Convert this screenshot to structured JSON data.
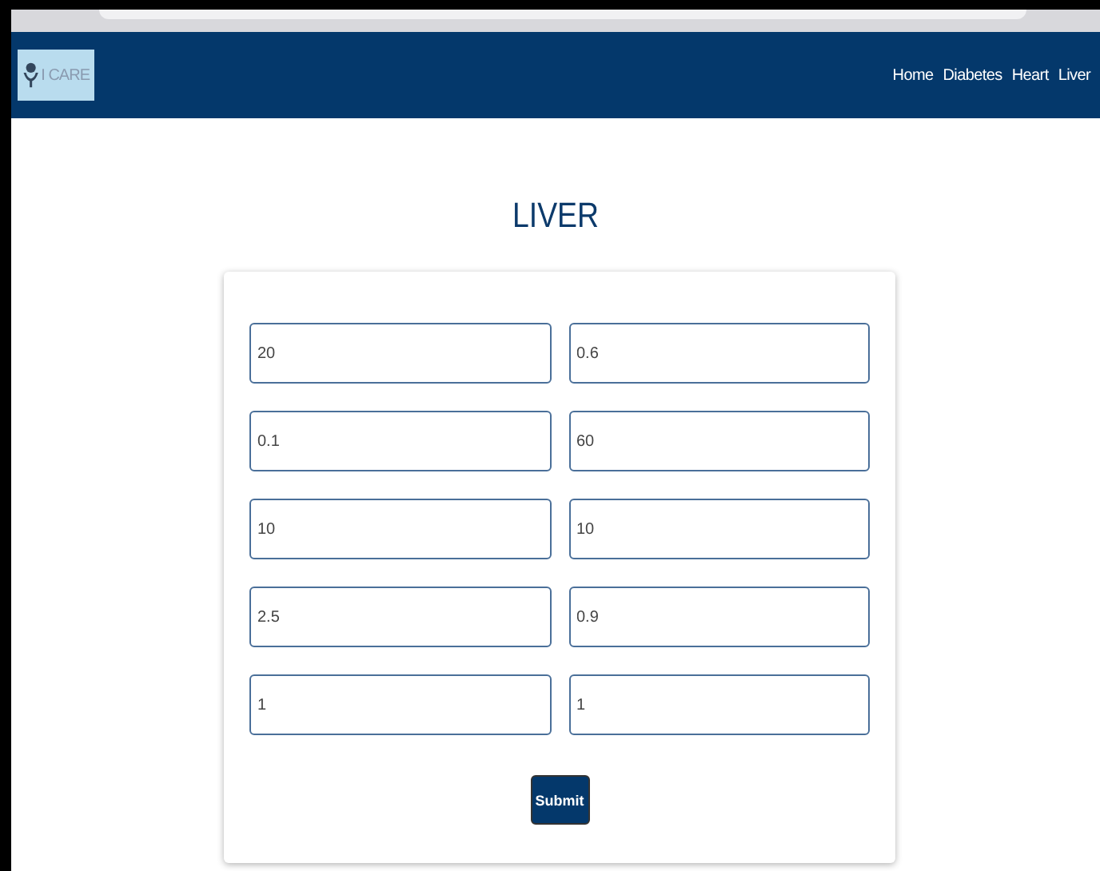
{
  "navbar": {
    "logo_text": "I CARE",
    "links": [
      {
        "label": "Home"
      },
      {
        "label": "Diabetes"
      },
      {
        "label": "Heart"
      },
      {
        "label": "Liver"
      }
    ]
  },
  "title": "LIVER",
  "fields": [
    {
      "value": "20"
    },
    {
      "value": "0.6"
    },
    {
      "value": "0.1"
    },
    {
      "value": "60"
    },
    {
      "value": "10"
    },
    {
      "value": "10"
    },
    {
      "value": "2.5"
    },
    {
      "value": "0.9"
    },
    {
      "value": "1"
    },
    {
      "value": "1"
    }
  ],
  "submit": "Submit"
}
